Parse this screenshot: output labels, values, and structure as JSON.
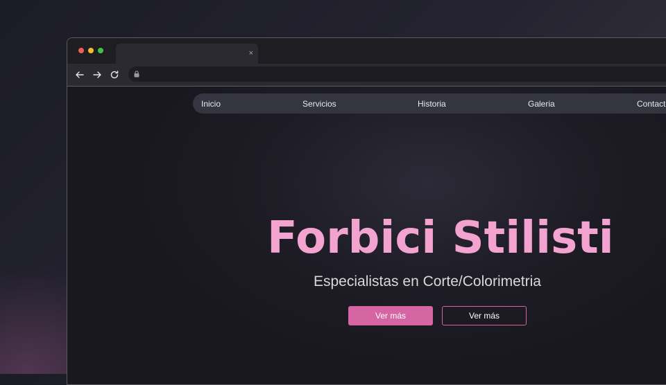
{
  "browser": {
    "tab": {
      "title": "",
      "close_label": "×"
    },
    "toolbar": {
      "back_icon": "arrow-left-icon",
      "forward_icon": "arrow-right-icon",
      "reload_icon": "reload-icon",
      "lock_icon": "lock-icon",
      "url": ""
    }
  },
  "site": {
    "nav": {
      "items": [
        "Inicio",
        "Servicios",
        "Historia",
        "Galeria",
        "Contacto"
      ]
    },
    "hero": {
      "title": "Forbici Stilisti",
      "subtitle": "Especialistas en Corte/Colorimetria",
      "primary_button": "Ver más",
      "secondary_button": "Ver más"
    }
  },
  "colors": {
    "accent": "#d565a3",
    "title_pink": "#f3a3cf",
    "nav_pill_bg": "#34353f",
    "window_red": "#ec5f56",
    "window_yellow": "#f2bc2f",
    "window_green": "#3fc248"
  }
}
